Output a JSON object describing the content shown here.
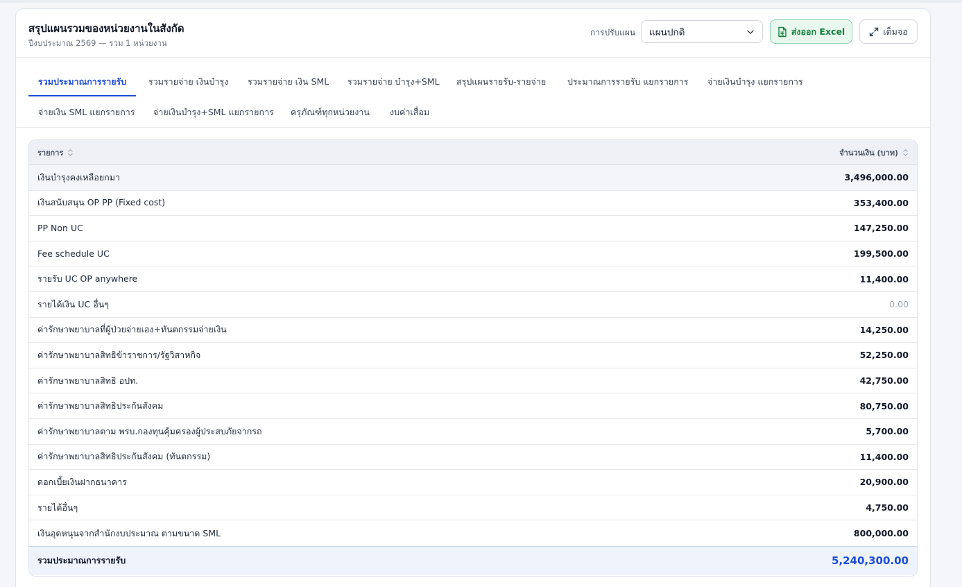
{
  "header": {
    "title": "สรุปแผนรวมของหน่วยงานในสังกัด",
    "subtitle": "ปีงบประมาณ 2569 — รวม 1 หน่วยงาน",
    "plan_label": "การปรับแผน",
    "plan_selected": "แผนปกติ",
    "export_label": "ส่งออก Excel",
    "fullscreen_label": "เต็มจอ"
  },
  "tabs": [
    {
      "label": "รวมประมาณการรายรับ"
    },
    {
      "label": "รวมรายจ่าย เงินบำรุง"
    },
    {
      "label": "รวมรายจ่าย เงิน SML"
    },
    {
      "label": "รวมรายจ่าย บำรุง+SML"
    },
    {
      "label": "สรุปแผนรายรับ-รายจ่าย"
    },
    {
      "label": "ประมาณการรายรับ แยกรายการ"
    },
    {
      "label": "จ่ายเงินบำรุง แยกรายการ"
    },
    {
      "label": "จ่ายเงิน SML แยกรายการ"
    },
    {
      "label": "จ่ายเงินบำรุง+SML แยกรายการ"
    },
    {
      "label": "ครุภัณฑ์ทุกหน่วยงาน"
    },
    {
      "label": "งบค่าเสื่อม"
    }
  ],
  "table": {
    "col_item": "รายการ",
    "col_amount": "จำนวนเงิน (บาท)",
    "rows": [
      {
        "name": "เงินบำรุงคงเหลือยกมา",
        "amount": "3,496,000.00"
      },
      {
        "name": "เงินสนับสนุน OP PP (Fixed cost)",
        "amount": "353,400.00"
      },
      {
        "name": "PP Non UC",
        "amount": "147,250.00"
      },
      {
        "name": "Fee schedule UC",
        "amount": "199,500.00"
      },
      {
        "name": "รายรับ UC OP anywhere",
        "amount": "11,400.00"
      },
      {
        "name": "รายได้เงิน UC อื่นๆ",
        "amount": "0.00"
      },
      {
        "name": "ค่ารักษาพยาบาลที่ผู้ป่วยจ่ายเอง+ทันตกรรมจ่ายเงิน",
        "amount": "14,250.00"
      },
      {
        "name": "ค่ารักษาพยาบาลสิทธิข้าราชการ/รัฐวิสาหกิจ",
        "amount": "52,250.00"
      },
      {
        "name": "ค่ารักษาพยาบาลสิทธิ อปท.",
        "amount": "42,750.00"
      },
      {
        "name": "ค่ารักษาพยาบาลสิทธิประกันสังคม",
        "amount": "80,750.00"
      },
      {
        "name": "ค่ารักษาพยาบาลตาม พรบ.กองทุนคุ้มครองผู้ประสบภัยจากรถ",
        "amount": "5,700.00"
      },
      {
        "name": "ค่ารักษาพยาบาลสิทธิประกันสังคม (ทันตกรรม)",
        "amount": "11,400.00"
      },
      {
        "name": "ดอกเบี้ยเงินฝากธนาคาร",
        "amount": "20,900.00"
      },
      {
        "name": "รายได้อื่นๆ",
        "amount": "4,750.00"
      },
      {
        "name": "เงินอุดหนุนจากสำนักงบประมาณ ตามขนาด SML",
        "amount": "800,000.00"
      }
    ],
    "total_label": "รวมประมาณการรายรับ",
    "total_amount": "5,240,300.00"
  }
}
